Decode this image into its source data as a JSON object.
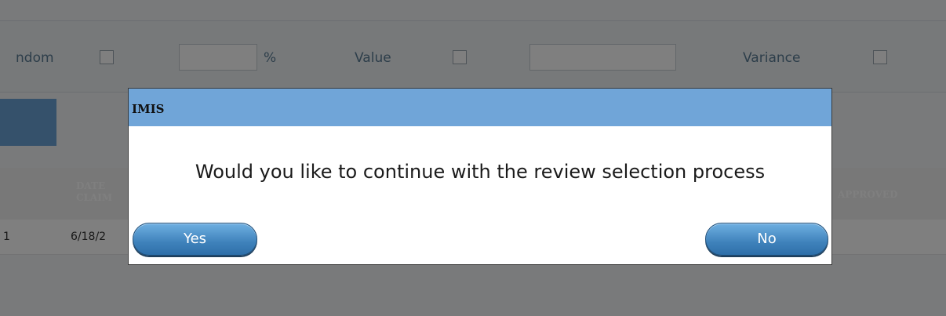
{
  "filters": {
    "random_label": "ndom",
    "percent_sign": "%",
    "value_label": "Value",
    "variance_label": "Variance"
  },
  "grid": {
    "header": {
      "date_line1": "DATE",
      "date_line2": "CLAIM",
      "approved": "APPROVED"
    },
    "row": {
      "first_cell": "1",
      "date_claimed": "6/18/2"
    }
  },
  "dialog": {
    "title": "IMIS",
    "message": "Would you like to continue with the review selection process",
    "yes_label": "Yes",
    "no_label": "No"
  },
  "colors": {
    "title_bar": "#70a5d8",
    "button": "#3f82bb",
    "overlay": "rgba(0,0,0,0.5)"
  }
}
